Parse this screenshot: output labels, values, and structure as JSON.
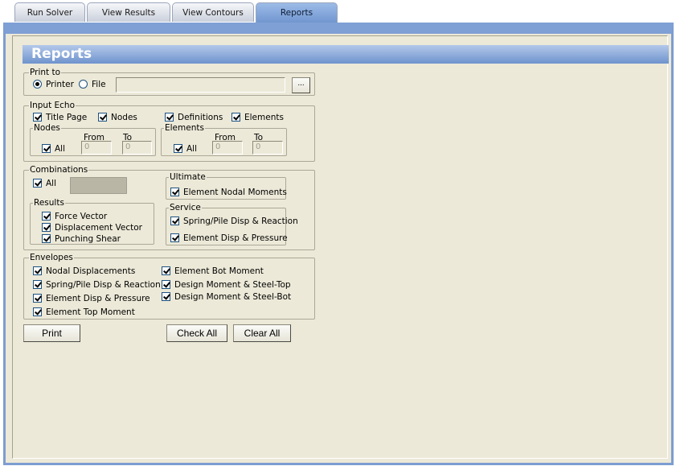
{
  "tabs": [
    "Run Solver",
    "View Results",
    "View Contours",
    "Reports"
  ],
  "banner_title": "Reports",
  "print_to": {
    "label": "Print to",
    "printer": "Printer",
    "file": "File",
    "file_path": "",
    "browse": "..."
  },
  "input_echo": {
    "label": "Input Echo",
    "title_page": "Title Page",
    "nodes": "Nodes",
    "definitions": "Definitions",
    "elements": "Elements",
    "nodes_group": {
      "label": "Nodes",
      "from": "From",
      "to": "To",
      "all": "All",
      "from_value": "0",
      "to_value": "0"
    },
    "elements_group": {
      "label": "Elements",
      "from": "From",
      "to": "To",
      "all": "All",
      "from_value": "0",
      "to_value": "0"
    }
  },
  "combinations": {
    "label": "Combinations",
    "all": "All",
    "results": {
      "label": "Results",
      "items": [
        "Force Vector",
        "Displacement Vector",
        "Punching Shear"
      ]
    },
    "ultimate": {
      "label": "Ultimate",
      "items": [
        "Element Nodal Moments"
      ]
    },
    "service": {
      "label": "Service",
      "items": [
        "Spring/Pile Disp & Reaction",
        "Element Disp & Pressure"
      ]
    }
  },
  "envelopes": {
    "label": "Envelopes",
    "left": [
      "Nodal Displacements",
      "Spring/Pile Disp & Reaction",
      "Element Disp & Pressure",
      "Element Top Moment"
    ],
    "right": [
      "Element Bot Moment",
      "Design Moment & Steel-Top",
      "Design Moment & Steel-Bot"
    ]
  },
  "buttons": {
    "print": "Print",
    "check_all": "Check All",
    "clear_all": "Clear All"
  }
}
